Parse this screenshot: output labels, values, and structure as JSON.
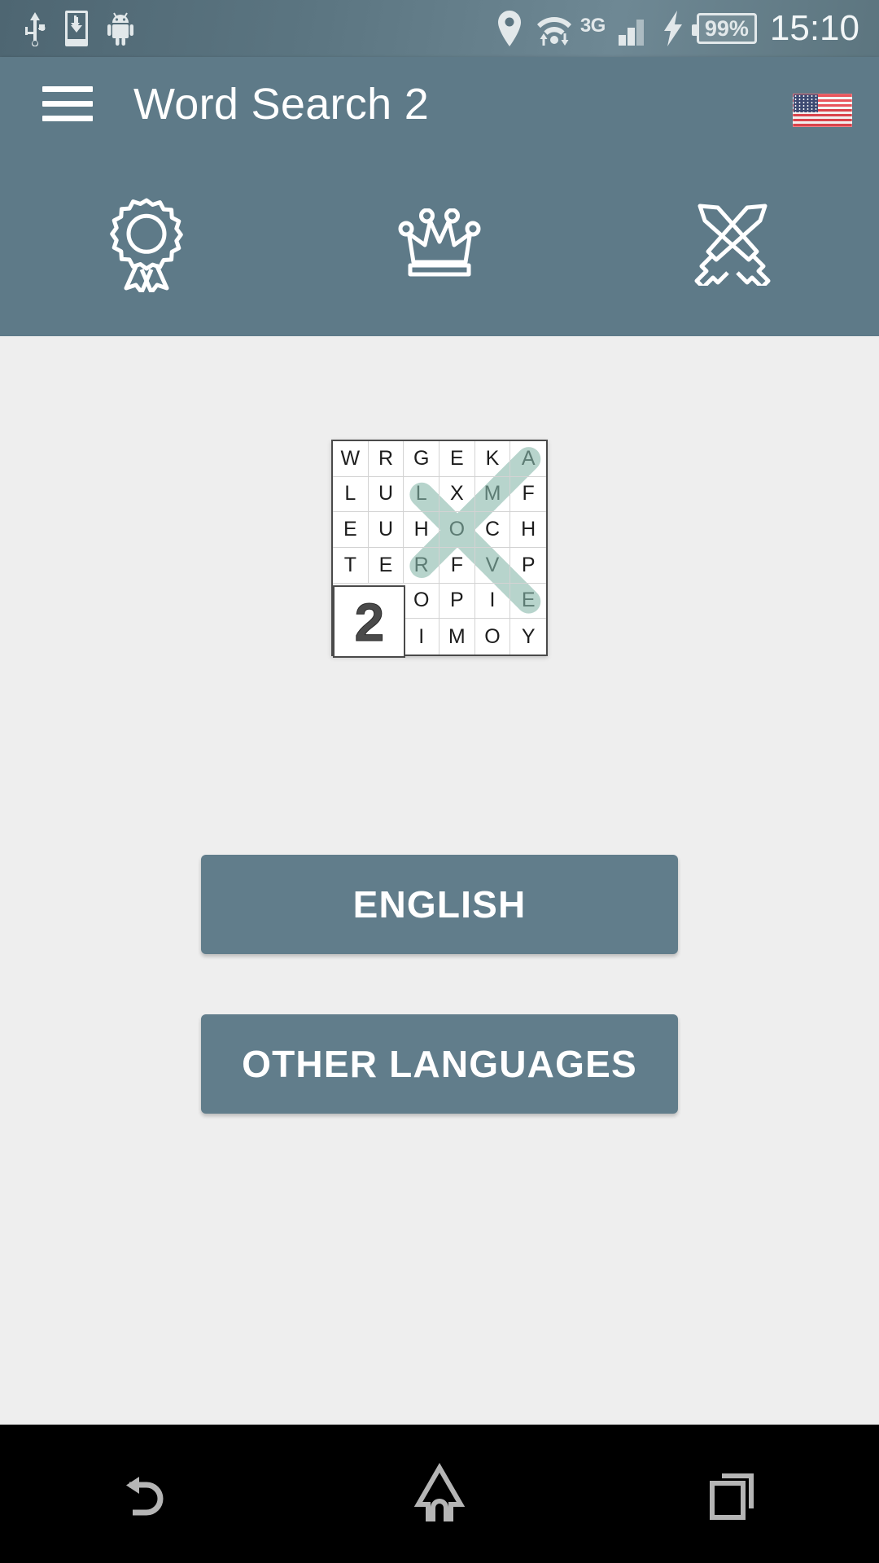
{
  "statusbar": {
    "icons": [
      "usb-icon",
      "sd-card-download-icon",
      "android-robot-icon",
      "location-pin-icon",
      "wifi-transfer-icon",
      "signal-bars-icon",
      "charging-bolt-icon"
    ],
    "network_label": "3G",
    "battery_label": "99%",
    "clock": "15:10"
  },
  "appbar": {
    "menu_icon": "hamburger-menu-icon",
    "title": "Word Search 2",
    "flag_icon": "us-flag-icon",
    "actions": [
      {
        "name": "achievements",
        "icon": "medal-ribbon-icon"
      },
      {
        "name": "leaderboard",
        "icon": "crown-icon"
      },
      {
        "name": "multiplayer",
        "icon": "crossed-swords-icon"
      }
    ]
  },
  "puzzle": {
    "badge": "2",
    "rows": 6,
    "cols": 6,
    "grid": [
      [
        "W",
        "R",
        "G",
        "E",
        "K",
        "A"
      ],
      [
        "L",
        "U",
        "L",
        "X",
        "M",
        "F"
      ],
      [
        "E",
        "U",
        "H",
        "O",
        "C",
        "H"
      ],
      [
        "T",
        "E",
        "R",
        "F",
        "V",
        "P"
      ],
      [
        "2",
        "2",
        "O",
        "P",
        "I",
        "E"
      ],
      [
        "2",
        "2",
        "I",
        "M",
        "O",
        "Y"
      ]
    ],
    "highlight_color": "#a8cbc2",
    "highlighted_cells": [
      {
        "row": 0,
        "col": 5
      },
      {
        "row": 1,
        "col": 2
      },
      {
        "row": 1,
        "col": 4
      },
      {
        "row": 2,
        "col": 3
      },
      {
        "row": 3,
        "col": 2
      },
      {
        "row": 3,
        "col": 4
      },
      {
        "row": 4,
        "col": 5
      }
    ],
    "found_words": [
      {
        "word": "LOVE",
        "start": {
          "row": 1,
          "col": 2
        },
        "end": {
          "row": 4,
          "col": 5
        }
      },
      {
        "word": "AMOR",
        "start": {
          "row": 0,
          "col": 5
        },
        "end": {
          "row": 3,
          "col": 2
        }
      }
    ]
  },
  "buttons": {
    "english": "ENGLISH",
    "other_languages": "OTHER LANGUAGES"
  },
  "navbar": {
    "back": "back-icon",
    "home": "home-icon",
    "recents": "recent-apps-icon"
  },
  "colors": {
    "appbar": "#5e7a88",
    "button": "#617d8b",
    "page_background": "#eeeeee",
    "highlight": "#a8cbc2"
  }
}
